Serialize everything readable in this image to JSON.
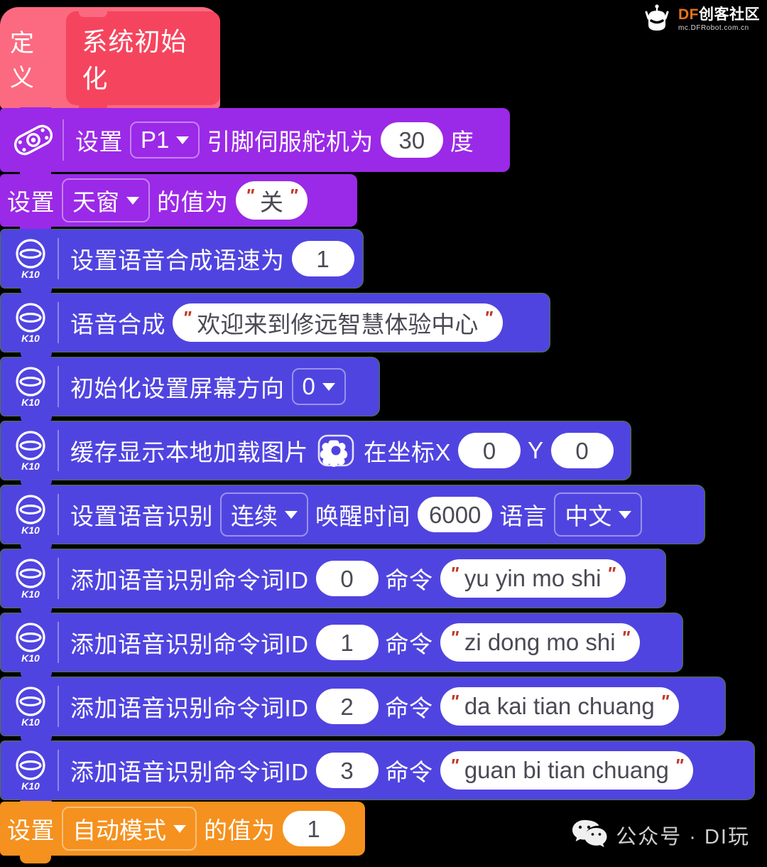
{
  "workspace": {
    "background": "#000000",
    "colors": {
      "hat": "#fb6a80",
      "hat_inner": "#f5455e",
      "servo_purple": "#9b29e8",
      "variable_purple": "#9b29e8",
      "k10_indigo": "#5044e0",
      "k10_outline": "#4e7a2e",
      "orange": "#f5911e",
      "field_white": "#ffffff",
      "field_text": "#4a4a55",
      "quote_red": "#c0392b"
    }
  },
  "hat_block": {
    "name": "define-block",
    "label": "定义",
    "procedure_name": "系统初始化"
  },
  "blocks": [
    {
      "id": "servo-set",
      "icon": "servo-icon",
      "parts": [
        {
          "type": "text",
          "value": "设置"
        },
        {
          "type": "dropdown",
          "value": "P1"
        },
        {
          "type": "text",
          "value": "引脚伺服舵机为"
        },
        {
          "type": "number",
          "value": "30"
        },
        {
          "type": "text",
          "value": "度"
        }
      ]
    },
    {
      "id": "set-variable-skylight",
      "icon": null,
      "parts": [
        {
          "type": "text",
          "value": "设置"
        },
        {
          "type": "dropdown",
          "value": "天窗"
        },
        {
          "type": "text",
          "value": "的值为"
        },
        {
          "type": "string",
          "value": "关"
        }
      ]
    },
    {
      "id": "tts-speed",
      "icon": "k10-icon",
      "parts": [
        {
          "type": "text",
          "value": "设置语音合成语速为"
        },
        {
          "type": "number",
          "value": "1"
        }
      ]
    },
    {
      "id": "tts-speak",
      "icon": "k10-icon",
      "parts": [
        {
          "type": "text",
          "value": "语音合成"
        },
        {
          "type": "string",
          "value": "欢迎来到修远智慧体验中心"
        }
      ]
    },
    {
      "id": "screen-orientation",
      "icon": "k10-icon",
      "parts": [
        {
          "type": "text",
          "value": "初始化设置屏幕方向"
        },
        {
          "type": "dropdown",
          "value": "0"
        }
      ]
    },
    {
      "id": "show-local-image",
      "icon": "k10-icon",
      "parts": [
        {
          "type": "text",
          "value": "缓存显示本地加载图片"
        },
        {
          "type": "image",
          "value": "picture-icon"
        },
        {
          "type": "text",
          "value": "在坐标X"
        },
        {
          "type": "number",
          "value": "0"
        },
        {
          "type": "text",
          "value": "Y"
        },
        {
          "type": "number",
          "value": "0"
        }
      ]
    },
    {
      "id": "asr-config",
      "icon": "k10-icon",
      "parts": [
        {
          "type": "text",
          "value": "设置语音识别"
        },
        {
          "type": "dropdown",
          "value": "连续"
        },
        {
          "type": "text",
          "value": "唤醒时间"
        },
        {
          "type": "number",
          "value": "6000"
        },
        {
          "type": "text",
          "value": "语言"
        },
        {
          "type": "dropdown",
          "value": "中文"
        }
      ]
    },
    {
      "id": "asr-add-command-0",
      "icon": "k10-icon",
      "parts": [
        {
          "type": "text",
          "value": "添加语音识别命令词ID"
        },
        {
          "type": "number",
          "value": "0"
        },
        {
          "type": "text",
          "value": "命令"
        },
        {
          "type": "string",
          "value": "yu yin mo shi"
        }
      ]
    },
    {
      "id": "asr-add-command-1",
      "icon": "k10-icon",
      "parts": [
        {
          "type": "text",
          "value": "添加语音识别命令词ID"
        },
        {
          "type": "number",
          "value": "1"
        },
        {
          "type": "text",
          "value": "命令"
        },
        {
          "type": "string",
          "value": "zi dong mo shi"
        }
      ]
    },
    {
      "id": "asr-add-command-2",
      "icon": "k10-icon",
      "parts": [
        {
          "type": "text",
          "value": "添加语音识别命令词ID"
        },
        {
          "type": "number",
          "value": "2"
        },
        {
          "type": "text",
          "value": "命令"
        },
        {
          "type": "string",
          "value": "da kai tian chuang"
        }
      ]
    },
    {
      "id": "asr-add-command-3",
      "icon": "k10-icon",
      "parts": [
        {
          "type": "text",
          "value": "添加语音识别命令词ID"
        },
        {
          "type": "number",
          "value": "3"
        },
        {
          "type": "text",
          "value": "命令"
        },
        {
          "type": "string",
          "value": "guan bi tian chuang"
        }
      ]
    },
    {
      "id": "set-variable-automode",
      "icon": null,
      "parts": [
        {
          "type": "text",
          "value": "设置"
        },
        {
          "type": "dropdown",
          "value": "自动模式"
        },
        {
          "type": "text",
          "value": "的值为"
        },
        {
          "type": "number",
          "value": "1"
        }
      ]
    }
  ],
  "k10_badge": "K10",
  "watermark_top": {
    "icon": "dfrobot-logo-icon",
    "brand_prefix": "DF",
    "brand_suffix": "创客社区",
    "url": "mc.DFRobot.com.cn"
  },
  "watermark_bottom": {
    "icon": "wechat-icon",
    "text": "公众号 · DI玩"
  }
}
